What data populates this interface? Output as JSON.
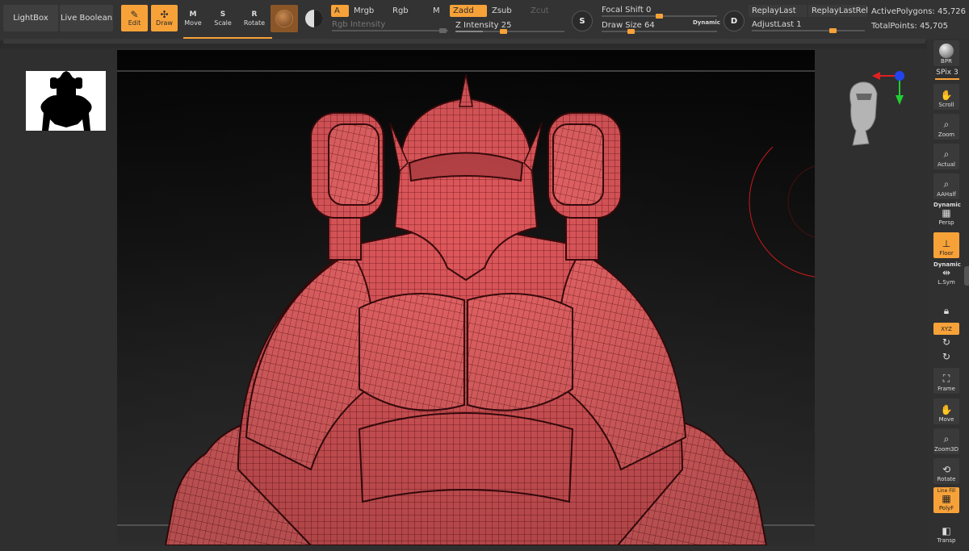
{
  "toolbar": {
    "lightbox": "LightBox",
    "live_boolean": "Live Boolean",
    "edit": "Edit",
    "draw": "Draw",
    "move": "Move",
    "scale": "Scale",
    "rotate": "Rotate",
    "move_key": "M",
    "scale_key": "S",
    "rotate_key": "R",
    "a": "A",
    "mrgb": "Mrgb",
    "rgb": "Rgb",
    "m": "M",
    "zadd": "Zadd",
    "zsub": "Zsub",
    "zcut": "Zcut",
    "rgb_intensity": "Rgb Intensity",
    "z_intensity_label": "Z Intensity",
    "z_intensity": "25",
    "z_intensity_level": 0.25,
    "focal_shift_label": "Focal Shift",
    "focal_shift": "0",
    "draw_size_label": "Draw Size",
    "draw_size": "64",
    "dynamic": "Dynamic",
    "s_key": "S",
    "d_key": "D",
    "replay_last": "ReplayLast",
    "replay_last_rel": "ReplayLastRel",
    "adjust_last_label": "AdjustLast",
    "adjust_last": "1",
    "active_polygons": "ActivePolygons: 45,726",
    "total_points": "TotalPoints: 45,705"
  },
  "right_shelf": {
    "bpr": "BPR",
    "spix_label": "SPix",
    "spix": "3",
    "scroll": "Scroll",
    "zoom": "Zoom",
    "actual": "Actual",
    "aahalf": "AAHalf",
    "dynamic": "Dynamic",
    "persp": "Persp",
    "floor": "Floor",
    "dynamic2": "Dynamic",
    "lsym": "L.Sym",
    "xyz": "XYZ",
    "frame": "Frame",
    "move": "Move",
    "zoom3d": "Zoom3D",
    "rotate": "Rotate",
    "line_fill": "Line Fill",
    "polyf": "PolyF",
    "transp": "Transp"
  },
  "colors": {
    "accent": "#f7a239",
    "mesh": "#e0585c",
    "wire": "#6a1518",
    "brush_ring": "#c8181c"
  },
  "icons": {
    "edit": "edit-pencil-icon",
    "draw": "draw-crosshair-icon",
    "material": "material-sphere-icon",
    "bpr": "sphere-icon",
    "scroll": "hand-icon",
    "zoom": "magnifier-icon"
  }
}
